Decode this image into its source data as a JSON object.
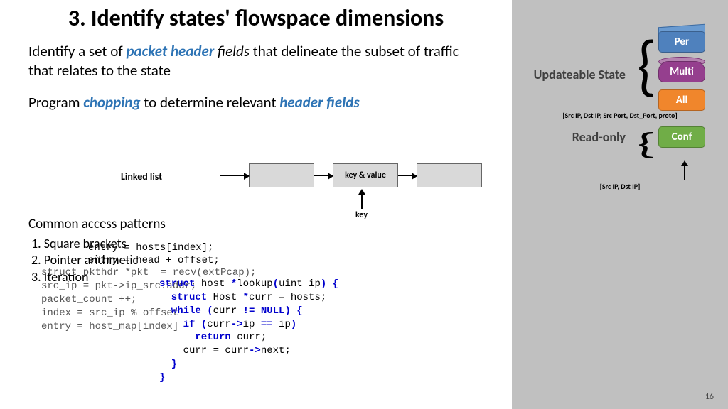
{
  "title": "3. Identify states' flowspace dimensions",
  "body": {
    "line1_pre": "Identify a set of ",
    "line1_hl": "packet header",
    "line1_mid": " fields",
    "line1_post": " that delineate the subset of traffic that relates to the state",
    "line2_pre": "Program ",
    "line2_hl1": "chopping",
    "line2_mid": " to determine relevant ",
    "line2_hl2": "header fields"
  },
  "linked_list": {
    "label": "Linked list",
    "kv": "key & value",
    "key": "key"
  },
  "patterns": {
    "heading": "Common access patterns",
    "items": [
      "1.   Square brackets",
      "2.   Pointer arithmetic",
      "3.   Iteration"
    ]
  },
  "code1": "entry = hosts[index];\nentry = head + offset;",
  "code2": "struct pkthdr *pkt  = recv(extPcap);\nsrc_ip = pkt->ip_src.addr;\npacket_count ++;\nindex = src_ip % offset\nentry = host_map[index]",
  "code3": {
    "l1a": "struct",
    "l1b": " host ",
    "l1c": "*",
    "l1d": "lookup",
    "l1e": "(",
    "l1f": "uint ip",
    "l1g": ") {",
    "l2a": "  struct",
    "l2b": " Host ",
    "l2c": "*",
    "l2d": "curr = hosts;",
    "l3a": "  while (",
    "l3b": "curr ",
    "l3c": "!= NULL",
    "l3d": ") {",
    "l4a": "    if (",
    "l4b": "curr",
    "l4c": "->",
    "l4d": "ip ",
    "l4e": "==",
    "l4f": " ip",
    "l4g": ")",
    "l5a": "      return",
    "l5b": " curr;",
    "l6a": "    curr = curr",
    "l6b": "->",
    "l6c": "next;",
    "l7": "  }",
    "l8": "}"
  },
  "sidebar": {
    "updateable": "Updateable State",
    "readonly": "Read-only",
    "per": "Per",
    "multi": "Multi",
    "all": "All",
    "conf": "Conf",
    "tuple1": "[Src IP, Dst IP, Src Port, Dst_Port, proto]",
    "tuple2": "[Src IP, Dst IP]"
  },
  "page": "16"
}
